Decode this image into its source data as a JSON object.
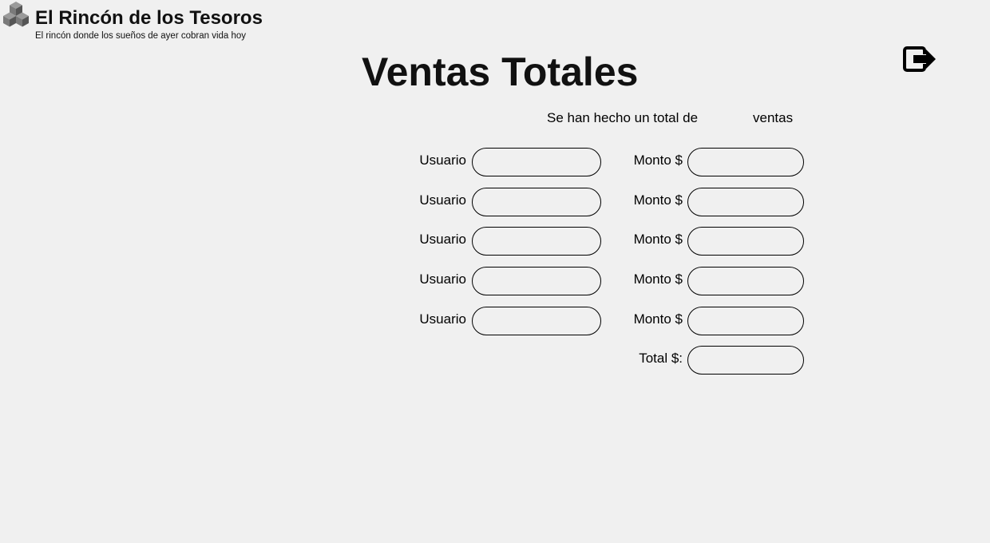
{
  "brand": {
    "title": "El Rincón de los Tesoros",
    "tagline": "El rincón donde los sueños de ayer cobran vida hoy",
    "logo_icon": "stacked-cubes-icon"
  },
  "page": {
    "title": "Ventas Totales",
    "logout_icon": "logout-icon"
  },
  "summary": {
    "prefix": "Se han hecho un total de",
    "count": "",
    "suffix": "ventas"
  },
  "sales": [
    {
      "user_label": "Usuario",
      "user_value": "",
      "amount_label": "Monto $",
      "amount_value": ""
    },
    {
      "user_label": "Usuario",
      "user_value": "",
      "amount_label": "Monto $",
      "amount_value": ""
    },
    {
      "user_label": "Usuario",
      "user_value": "",
      "amount_label": "Monto $",
      "amount_value": ""
    },
    {
      "user_label": "Usuario",
      "user_value": "",
      "amount_label": "Monto $",
      "amount_value": ""
    },
    {
      "user_label": "Usuario",
      "user_value": "",
      "amount_label": "Monto $",
      "amount_value": ""
    }
  ],
  "total": {
    "label": "Total $:",
    "value": ""
  }
}
